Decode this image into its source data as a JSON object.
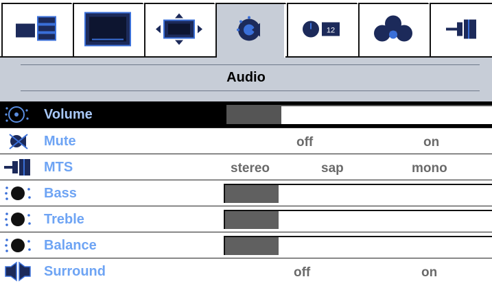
{
  "tabs": [
    {
      "icon": "picture-layout-icon",
      "active": false
    },
    {
      "icon": "screen-icon",
      "active": false
    },
    {
      "icon": "position-icon",
      "active": false
    },
    {
      "icon": "audio-icon",
      "active": true
    },
    {
      "icon": "clock-timer-icon",
      "active": false,
      "badge": "12"
    },
    {
      "icon": "color-balls-icon",
      "active": false
    },
    {
      "icon": "connector-icon",
      "active": false
    }
  ],
  "title": "Audio",
  "rows": [
    {
      "icon": "volume-icon",
      "label": "Volume",
      "type": "slider",
      "level": 0.2,
      "selected": true
    },
    {
      "icon": "mute-icon",
      "label": "Mute",
      "type": "options",
      "options": [
        "off",
        "on"
      ]
    },
    {
      "icon": "mts-icon",
      "label": "MTS",
      "type": "options",
      "options": [
        "stereo",
        "sap",
        "mono"
      ]
    },
    {
      "icon": "bass-icon",
      "label": "Bass",
      "type": "slider",
      "level": 0.2
    },
    {
      "icon": "treble-icon",
      "label": "Treble",
      "type": "slider",
      "level": 0.2
    },
    {
      "icon": "balance-icon",
      "label": "Balance",
      "type": "slider",
      "level": 0.2
    },
    {
      "icon": "surround-icon",
      "label": "Surround",
      "type": "options",
      "options": [
        "off",
        "on"
      ]
    }
  ],
  "colors": {
    "label_blue": "#6ea4f4",
    "panel_gray": "#c7cdd7",
    "icon_navy": "#1c2a5a",
    "option_gray": "#6a6a6a"
  }
}
